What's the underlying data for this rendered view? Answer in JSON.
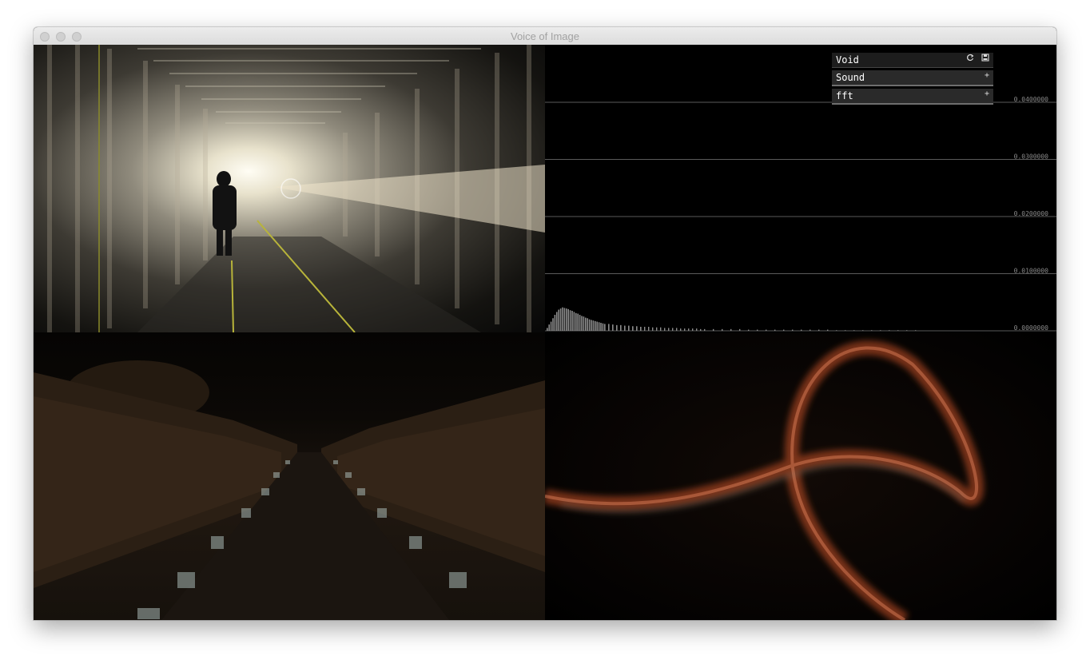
{
  "window": {
    "title": "Voice of Image"
  },
  "gui": {
    "panel_title": "Void",
    "icons": [
      "refresh-icon",
      "save-icon"
    ],
    "groups": [
      {
        "label": "Sound",
        "expand_symbol": "+"
      },
      {
        "label": "fft",
        "expand_symbol": "+"
      }
    ]
  },
  "chart_data": {
    "type": "bar",
    "title": "",
    "xlabel": "",
    "ylabel": "",
    "ylim": [
      0,
      0.04
    ],
    "yticks": [
      "0.0400000",
      "0.0300000",
      "0.0200000",
      "0.0100000",
      "0.0000000"
    ],
    "grid": true,
    "series_color": "#8c8c8c",
    "values": [
      0.0005,
      0.0011,
      0.0016,
      0.0022,
      0.0028,
      0.0033,
      0.0037,
      0.0039,
      0.0041,
      0.004,
      0.0039,
      0.0038,
      0.0036,
      0.0035,
      0.0033,
      0.0031,
      0.003,
      0.0028,
      0.0026,
      0.0025,
      0.0023,
      0.0022,
      0.002,
      0.0019,
      0.0018,
      0.0017,
      0.0016,
      0.0015,
      0.0014,
      0.0013,
      0.0012,
      0.0012,
      0.0011,
      0.001,
      0.001,
      0.0009,
      0.0009,
      0.0008,
      0.0008,
      0.0007,
      0.0007,
      0.0007,
      0.0006,
      0.0006,
      0.0006,
      0.0005,
      0.0005,
      0.0005,
      0.0005,
      0.0004,
      0.0004,
      0.0004,
      0.0004,
      0.0004,
      0.0003,
      0.0003,
      0.0003,
      0.0003,
      0.0003,
      0.0003,
      0.0002,
      0.0002,
      0.0002,
      0.0002,
      0.0002,
      0.0002,
      0.0002,
      0.0002,
      0.0002,
      0.0002,
      0.0001,
      0.0001,
      0.0001,
      0.0001,
      0.0001,
      0.0001,
      0.0001,
      0.0001,
      0.0001,
      0.0001
    ]
  }
}
